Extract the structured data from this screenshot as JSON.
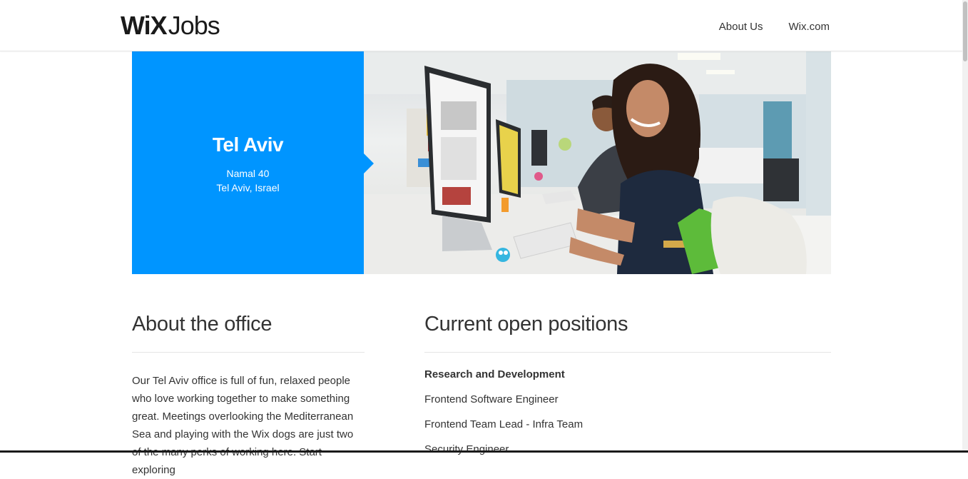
{
  "header": {
    "logo_wix": "WiX",
    "logo_jobs": "Jobs",
    "nav": [
      {
        "label": "About Us"
      },
      {
        "label": "Wix.com"
      }
    ]
  },
  "hero": {
    "city": "Tel Aviv",
    "address_line1": "Namal 40",
    "address_line2": "Tel Aviv, Israel",
    "accent_color": "#0095ff"
  },
  "about": {
    "title": "About the office",
    "text": "Our Tel Aviv office is full of fun, relaxed people who love working together to make something great. Meetings overlooking the Mediterranean Sea and playing with the Wix dogs are just two of the many perks of working here. Start exploring"
  },
  "positions": {
    "title": "Current open positions",
    "department": "Research and Development",
    "jobs": [
      {
        "label": "Frontend Software Engineer"
      },
      {
        "label": "Frontend Team Lead - Infra Team"
      },
      {
        "label": "Security Engineer"
      }
    ]
  }
}
